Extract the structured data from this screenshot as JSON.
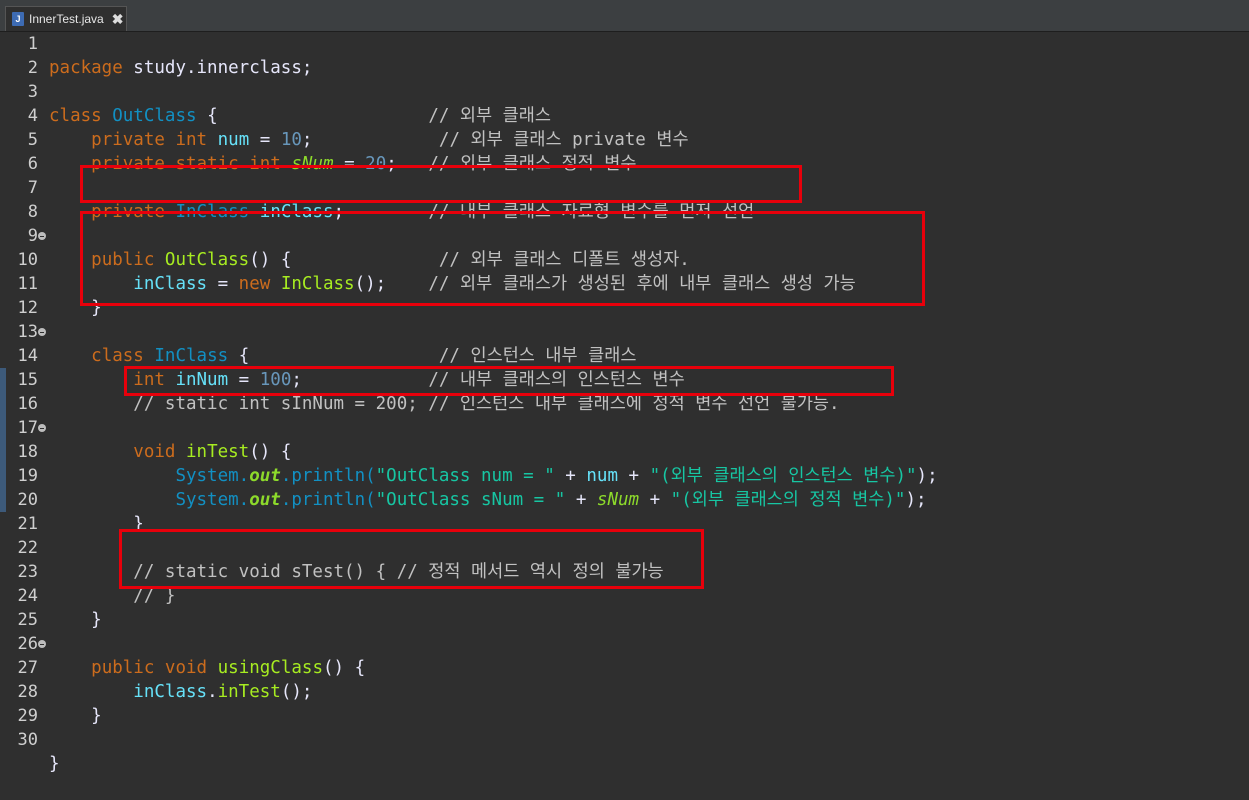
{
  "tab": {
    "title": "InnerTest.java",
    "icon": "J",
    "close": "✖"
  },
  "lines": [
    {
      "n": "1"
    },
    {
      "n": "2"
    },
    {
      "n": "3"
    },
    {
      "n": "4"
    },
    {
      "n": "5"
    },
    {
      "n": "6"
    },
    {
      "n": "7"
    },
    {
      "n": "8"
    },
    {
      "n": "9"
    },
    {
      "n": "10"
    },
    {
      "n": "11"
    },
    {
      "n": "12"
    },
    {
      "n": "13"
    },
    {
      "n": "14"
    },
    {
      "n": "15"
    },
    {
      "n": "16"
    },
    {
      "n": "17"
    },
    {
      "n": "18"
    },
    {
      "n": "19"
    },
    {
      "n": "20"
    },
    {
      "n": "21"
    },
    {
      "n": "22"
    },
    {
      "n": "23"
    },
    {
      "n": "24"
    },
    {
      "n": "25"
    },
    {
      "n": "26"
    },
    {
      "n": "27"
    },
    {
      "n": "28"
    },
    {
      "n": "29"
    },
    {
      "n": "30"
    }
  ],
  "code": {
    "l1": {
      "kw": "package",
      "rest": " study.innerclass;"
    },
    "l3": {
      "kw": "class",
      "cls": "OutClass",
      "brace": " {",
      "pad": "                    ",
      "cm": "// 외부 클래스"
    },
    "l4": {
      "kw1": "private",
      "kw2": "int",
      "field": "num",
      "eq": " = ",
      "num": "10",
      "semi": ";",
      "pad": "            ",
      "cm": "// 외부 클래스 private 변수"
    },
    "l5": {
      "kw1": "private",
      "kw2": "static",
      "kw3": "int",
      "field": "sNum",
      "eq": " = ",
      "num": "20",
      "semi": ";",
      "pad": "   ",
      "cm": "// 외부 클래스 정적 변수"
    },
    "l7": {
      "kw": "private",
      "cls": "InClass",
      "field": "inClass",
      "semi": ";",
      "pad": "        ",
      "cm": "// 내부 클래스 자료형 변수를 먼저 선언"
    },
    "l9": {
      "kw": "public",
      "ctor": "OutClass",
      "rest": "() {",
      "pad": "              ",
      "cm": "// 외부 클래스 디폴트 생성자."
    },
    "l10": {
      "field": "inClass",
      "eq": " = ",
      "kw": "new",
      "cls": "InClass",
      "rest": "();",
      "pad": "    ",
      "cm": "// 외부 클래스가 생성된 후에 내부 클래스 생성 가능"
    },
    "l11": {
      "rest": "}"
    },
    "l13": {
      "kw": "class",
      "cls": "InClass",
      "brace": " {",
      "pad": "                  ",
      "cm": "// 인스턴스 내부 클래스"
    },
    "l14": {
      "kw": "int",
      "field": "inNum",
      "eq": " = ",
      "num": "100",
      "semi": ";",
      "pad": "            ",
      "cm": "// 내부 클래스의 인스턴스 변수"
    },
    "l15": {
      "cm": "// static int sInNum = 200; // 인스턴스 내부 클래스에 정적 변수 선언 불가능."
    },
    "l17": {
      "kw": "void",
      "method": "inTest",
      "rest": "() {"
    },
    "l18": {
      "sys": "System.",
      "out": "out",
      "println": ".println(",
      "str1": "\"OutClass num = \"",
      "plus1": " + ",
      "var": "num",
      "plus2": " + ",
      "str2": "\"(외부 클래스의 인스턴스 변수)\"",
      "end": ");"
    },
    "l19": {
      "sys": "System.",
      "out": "out",
      "println": ".println(",
      "str1": "\"OutClass sNum = \"",
      "plus1": " + ",
      "var": "sNum",
      "plus2": " + ",
      "str2": "\"(외부 클래스의 정적 변수)\"",
      "end": ");"
    },
    "l20": {
      "rest": "}"
    },
    "l22": {
      "cm": "// static void sTest() { // 정적 메서드 역시 정의 불가능"
    },
    "l23": {
      "cm": "// }"
    },
    "l24": {
      "rest": "}"
    },
    "l26": {
      "kw1": "public",
      "kw2": "void",
      "method": "usingClass",
      "rest": "() {"
    },
    "l27": {
      "field": "inClass",
      "dot": ".",
      "method": "inTest",
      "rest": "();"
    },
    "l28": {
      "rest": "}"
    },
    "l30": {
      "rest": "}"
    }
  }
}
